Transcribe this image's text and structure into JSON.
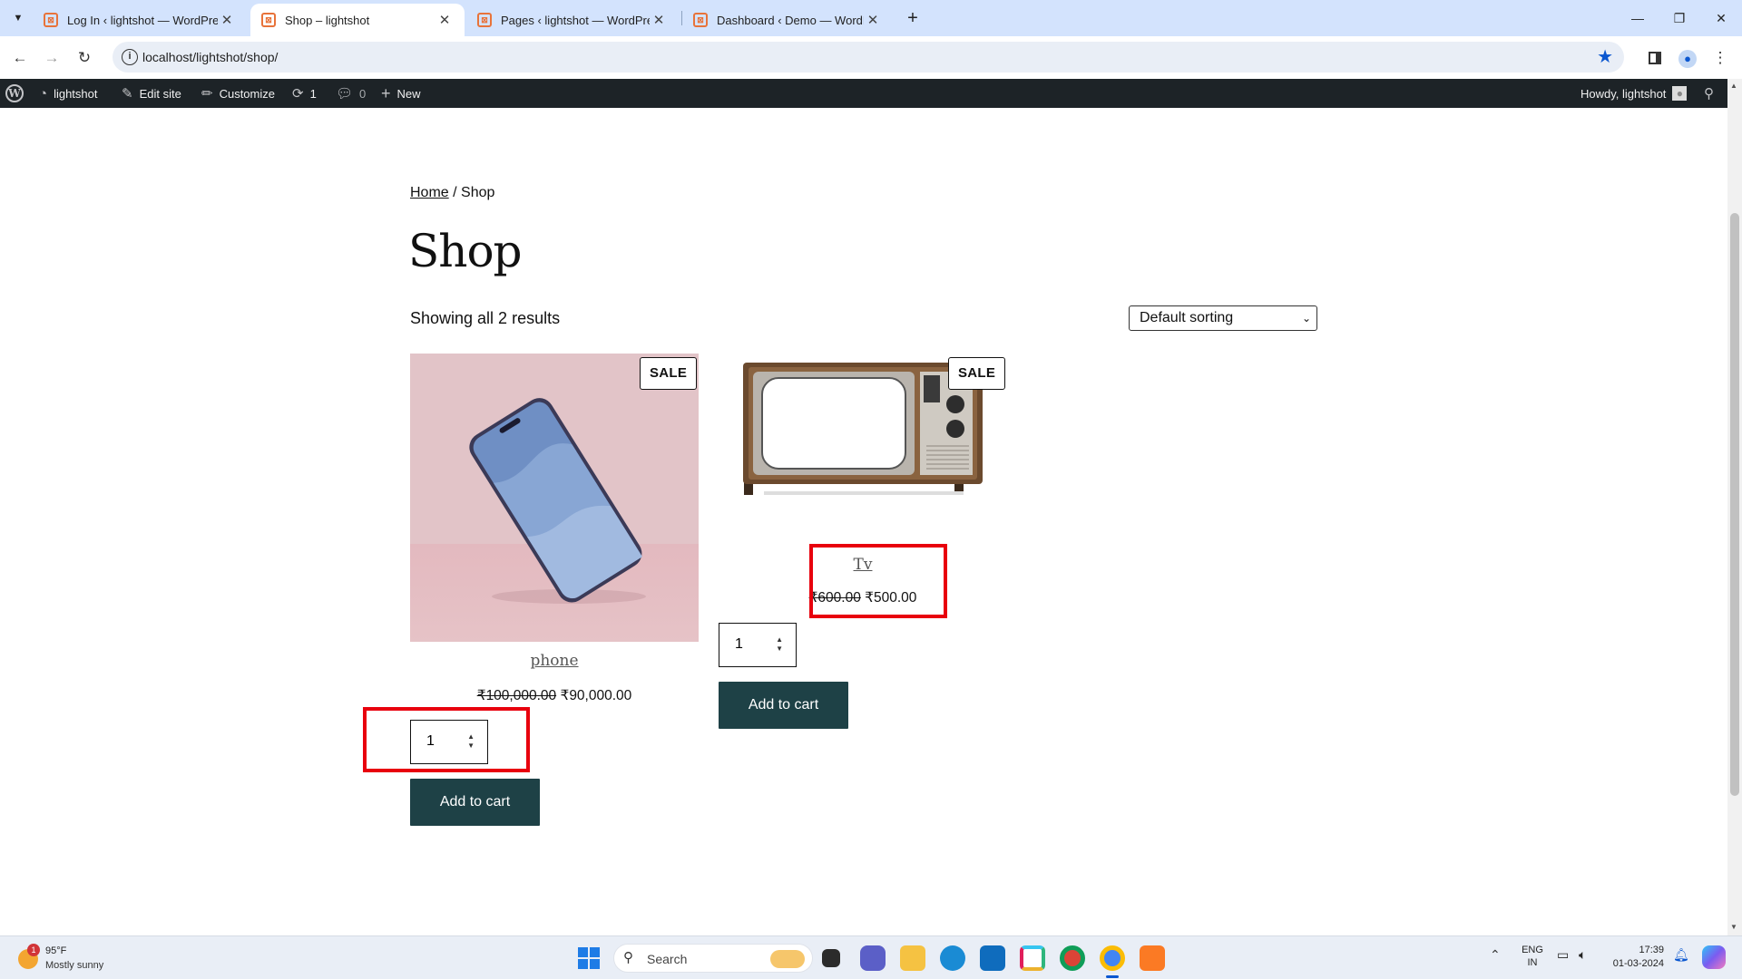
{
  "browser": {
    "tabs": [
      {
        "title": "Log In ‹ lightshot — WordPress",
        "active": false
      },
      {
        "title": "Shop – lightshot",
        "active": true
      },
      {
        "title": "Pages ‹ lightshot — WordPress",
        "active": false
      },
      {
        "title": "Dashboard ‹ Demo — WordPre",
        "active": false
      }
    ],
    "new_tab_label": "+",
    "url": "localhost/lightshot/shop/"
  },
  "adminbar": {
    "site_name": "lightshot",
    "edit_site": "Edit site",
    "customize": "Customize",
    "updates_count": "1",
    "comments_count": "0",
    "new_label": "New",
    "howdy": "Howdy, lightshot"
  },
  "page": {
    "breadcrumb_home": "Home",
    "breadcrumb_sep": " / ",
    "breadcrumb_current": "Shop",
    "title": "Shop",
    "result_count": "Showing all 2 results",
    "sorting_value": "Default sorting"
  },
  "products": [
    {
      "name": "phone",
      "sale_badge": "SALE",
      "regular_price": "₹100,000.00",
      "sale_price": "₹90,000.00",
      "quantity": "1",
      "button": "Add to cart"
    },
    {
      "name": "Tv",
      "sale_badge": "SALE",
      "regular_price": "₹600.00",
      "sale_price": "₹500.00",
      "quantity": "1",
      "button": "Add to cart"
    }
  ],
  "taskbar": {
    "weather_temp": "95°F",
    "weather_desc": "Mostly sunny",
    "weather_badge": "1",
    "search_placeholder": "Search",
    "lang_top": "ENG",
    "lang_bottom": "IN",
    "time": "17:39",
    "date": "01-03-2024"
  },
  "colors": {
    "cart_button": "#1e4146",
    "annotation_red": "#e8000d",
    "adminbar": "#1d2327",
    "tabstrip": "#d3e3fd"
  }
}
